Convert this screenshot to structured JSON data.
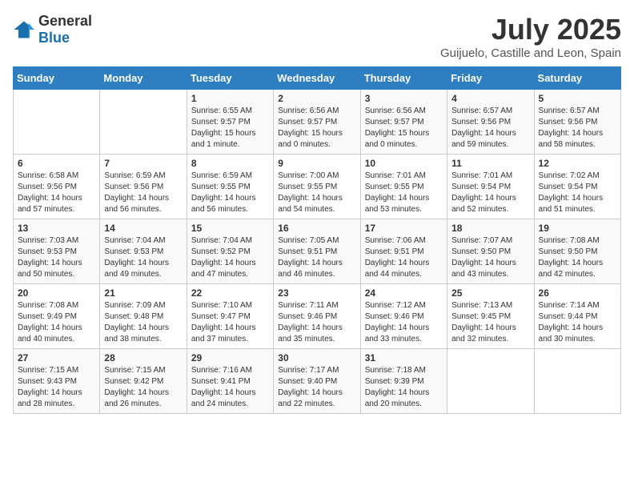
{
  "header": {
    "logo_general": "General",
    "logo_blue": "Blue",
    "title": "July 2025",
    "subtitle": "Guijuelo, Castille and Leon, Spain"
  },
  "weekdays": [
    "Sunday",
    "Monday",
    "Tuesday",
    "Wednesday",
    "Thursday",
    "Friday",
    "Saturday"
  ],
  "weeks": [
    [
      {
        "day": "",
        "sunrise": "",
        "sunset": "",
        "daylight": "",
        "empty": true
      },
      {
        "day": "",
        "sunrise": "",
        "sunset": "",
        "daylight": "",
        "empty": true
      },
      {
        "day": "1",
        "sunrise": "Sunrise: 6:55 AM",
        "sunset": "Sunset: 9:57 PM",
        "daylight": "Daylight: 15 hours and 1 minute."
      },
      {
        "day": "2",
        "sunrise": "Sunrise: 6:56 AM",
        "sunset": "Sunset: 9:57 PM",
        "daylight": "Daylight: 15 hours and 0 minutes."
      },
      {
        "day": "3",
        "sunrise": "Sunrise: 6:56 AM",
        "sunset": "Sunset: 9:57 PM",
        "daylight": "Daylight: 15 hours and 0 minutes."
      },
      {
        "day": "4",
        "sunrise": "Sunrise: 6:57 AM",
        "sunset": "Sunset: 9:56 PM",
        "daylight": "Daylight: 14 hours and 59 minutes."
      },
      {
        "day": "5",
        "sunrise": "Sunrise: 6:57 AM",
        "sunset": "Sunset: 9:56 PM",
        "daylight": "Daylight: 14 hours and 58 minutes."
      }
    ],
    [
      {
        "day": "6",
        "sunrise": "Sunrise: 6:58 AM",
        "sunset": "Sunset: 9:56 PM",
        "daylight": "Daylight: 14 hours and 57 minutes."
      },
      {
        "day": "7",
        "sunrise": "Sunrise: 6:59 AM",
        "sunset": "Sunset: 9:56 PM",
        "daylight": "Daylight: 14 hours and 56 minutes."
      },
      {
        "day": "8",
        "sunrise": "Sunrise: 6:59 AM",
        "sunset": "Sunset: 9:55 PM",
        "daylight": "Daylight: 14 hours and 56 minutes."
      },
      {
        "day": "9",
        "sunrise": "Sunrise: 7:00 AM",
        "sunset": "Sunset: 9:55 PM",
        "daylight": "Daylight: 14 hours and 54 minutes."
      },
      {
        "day": "10",
        "sunrise": "Sunrise: 7:01 AM",
        "sunset": "Sunset: 9:55 PM",
        "daylight": "Daylight: 14 hours and 53 minutes."
      },
      {
        "day": "11",
        "sunrise": "Sunrise: 7:01 AM",
        "sunset": "Sunset: 9:54 PM",
        "daylight": "Daylight: 14 hours and 52 minutes."
      },
      {
        "day": "12",
        "sunrise": "Sunrise: 7:02 AM",
        "sunset": "Sunset: 9:54 PM",
        "daylight": "Daylight: 14 hours and 51 minutes."
      }
    ],
    [
      {
        "day": "13",
        "sunrise": "Sunrise: 7:03 AM",
        "sunset": "Sunset: 9:53 PM",
        "daylight": "Daylight: 14 hours and 50 minutes."
      },
      {
        "day": "14",
        "sunrise": "Sunrise: 7:04 AM",
        "sunset": "Sunset: 9:53 PM",
        "daylight": "Daylight: 14 hours and 49 minutes."
      },
      {
        "day": "15",
        "sunrise": "Sunrise: 7:04 AM",
        "sunset": "Sunset: 9:52 PM",
        "daylight": "Daylight: 14 hours and 47 minutes."
      },
      {
        "day": "16",
        "sunrise": "Sunrise: 7:05 AM",
        "sunset": "Sunset: 9:51 PM",
        "daylight": "Daylight: 14 hours and 46 minutes."
      },
      {
        "day": "17",
        "sunrise": "Sunrise: 7:06 AM",
        "sunset": "Sunset: 9:51 PM",
        "daylight": "Daylight: 14 hours and 44 minutes."
      },
      {
        "day": "18",
        "sunrise": "Sunrise: 7:07 AM",
        "sunset": "Sunset: 9:50 PM",
        "daylight": "Daylight: 14 hours and 43 minutes."
      },
      {
        "day": "19",
        "sunrise": "Sunrise: 7:08 AM",
        "sunset": "Sunset: 9:50 PM",
        "daylight": "Daylight: 14 hours and 42 minutes."
      }
    ],
    [
      {
        "day": "20",
        "sunrise": "Sunrise: 7:08 AM",
        "sunset": "Sunset: 9:49 PM",
        "daylight": "Daylight: 14 hours and 40 minutes."
      },
      {
        "day": "21",
        "sunrise": "Sunrise: 7:09 AM",
        "sunset": "Sunset: 9:48 PM",
        "daylight": "Daylight: 14 hours and 38 minutes."
      },
      {
        "day": "22",
        "sunrise": "Sunrise: 7:10 AM",
        "sunset": "Sunset: 9:47 PM",
        "daylight": "Daylight: 14 hours and 37 minutes."
      },
      {
        "day": "23",
        "sunrise": "Sunrise: 7:11 AM",
        "sunset": "Sunset: 9:46 PM",
        "daylight": "Daylight: 14 hours and 35 minutes."
      },
      {
        "day": "24",
        "sunrise": "Sunrise: 7:12 AM",
        "sunset": "Sunset: 9:46 PM",
        "daylight": "Daylight: 14 hours and 33 minutes."
      },
      {
        "day": "25",
        "sunrise": "Sunrise: 7:13 AM",
        "sunset": "Sunset: 9:45 PM",
        "daylight": "Daylight: 14 hours and 32 minutes."
      },
      {
        "day": "26",
        "sunrise": "Sunrise: 7:14 AM",
        "sunset": "Sunset: 9:44 PM",
        "daylight": "Daylight: 14 hours and 30 minutes."
      }
    ],
    [
      {
        "day": "27",
        "sunrise": "Sunrise: 7:15 AM",
        "sunset": "Sunset: 9:43 PM",
        "daylight": "Daylight: 14 hours and 28 minutes."
      },
      {
        "day": "28",
        "sunrise": "Sunrise: 7:15 AM",
        "sunset": "Sunset: 9:42 PM",
        "daylight": "Daylight: 14 hours and 26 minutes."
      },
      {
        "day": "29",
        "sunrise": "Sunrise: 7:16 AM",
        "sunset": "Sunset: 9:41 PM",
        "daylight": "Daylight: 14 hours and 24 minutes."
      },
      {
        "day": "30",
        "sunrise": "Sunrise: 7:17 AM",
        "sunset": "Sunset: 9:40 PM",
        "daylight": "Daylight: 14 hours and 22 minutes."
      },
      {
        "day": "31",
        "sunrise": "Sunrise: 7:18 AM",
        "sunset": "Sunset: 9:39 PM",
        "daylight": "Daylight: 14 hours and 20 minutes."
      },
      {
        "day": "",
        "sunrise": "",
        "sunset": "",
        "daylight": "",
        "empty": true
      },
      {
        "day": "",
        "sunrise": "",
        "sunset": "",
        "daylight": "",
        "empty": true
      }
    ]
  ]
}
